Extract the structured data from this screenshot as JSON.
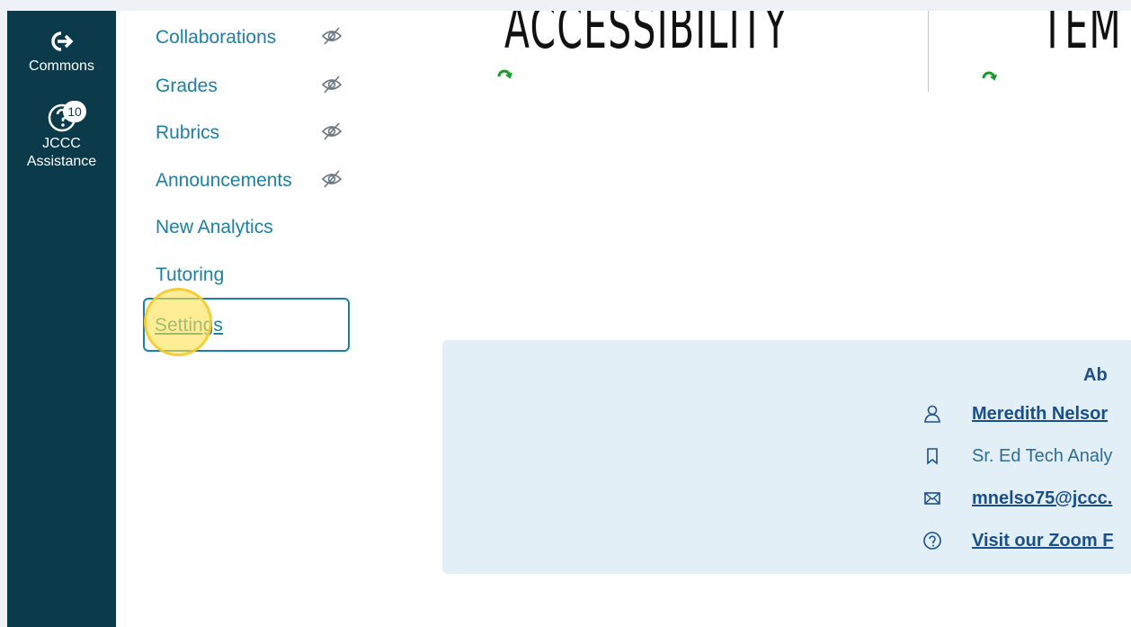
{
  "global_nav": {
    "commons_label": "Commons",
    "assistance_label_line1": "JCCC",
    "assistance_label_line2": "Assistance",
    "assistance_badge": "10"
  },
  "course_nav": {
    "items": [
      {
        "label": "Collaborations",
        "hidden_from_students": true
      },
      {
        "label": "Grades",
        "hidden_from_students": true
      },
      {
        "label": "Rubrics",
        "hidden_from_students": true
      },
      {
        "label": "Announcements",
        "hidden_from_students": true
      },
      {
        "label": "New Analytics",
        "hidden_from_students": false
      },
      {
        "label": "Tutoring",
        "hidden_from_students": false
      }
    ],
    "settings_label": "Settings"
  },
  "banner": {
    "left_text": "ACCESSIBILITY",
    "right_text": "TEM"
  },
  "about": {
    "heading": "Ab",
    "name": "Meredith Nelsor",
    "title": "Sr. Ed Tech Analy",
    "email": "mnelso75@jccc.",
    "zoom": "Visit our Zoom F"
  },
  "colors": {
    "nav_bg": "#0b3a4a",
    "link": "#1b80a3",
    "card_bg": "#e3eff6",
    "highlight": "#ffe150"
  }
}
